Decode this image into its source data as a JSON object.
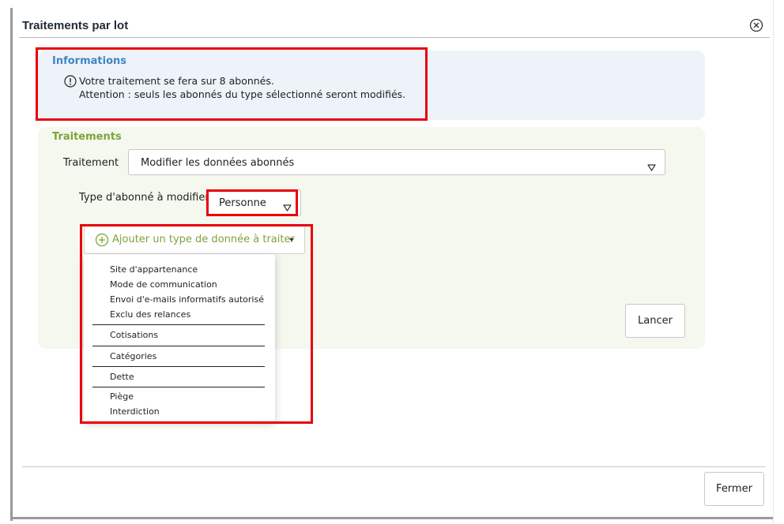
{
  "dialog": {
    "title": "Traitements par lot",
    "close_icon": "close-circle-icon"
  },
  "informations": {
    "heading": "Informations",
    "icon": "info-circle-icon",
    "line1": "Votre traitement se fera sur 8 abonnés.",
    "line2": "Attention : seuls les abonnés du type sélectionné seront modifiés."
  },
  "traitements": {
    "heading": "Traitements",
    "traitement_label": "Traitement",
    "traitement_value": "Modifier les données abonnés",
    "type_label": "Type d'abonné à modifier",
    "type_value": "Personne",
    "add_button_label": "Ajouter un type de donnée à traiter",
    "add_icon": "plus-circle-icon",
    "launch_label": "Lancer"
  },
  "dropdown": {
    "groups": [
      [
        "Site d'appartenance",
        "Mode de communication",
        "Envoi d'e-mails informatifs autorisé",
        "Exclu des relances"
      ],
      [
        "Cotisations"
      ],
      [
        "Catégories"
      ],
      [
        "Dette"
      ],
      [
        "Piège",
        "Interdiction"
      ]
    ]
  },
  "footer": {
    "close_label": "Fermer"
  },
  "colors": {
    "highlight": "#e8000b",
    "info_heading": "#3f86c5",
    "treat_heading": "#7ea33a",
    "info_bg": "#eef3f9",
    "treat_bg": "#f4f8ee"
  }
}
